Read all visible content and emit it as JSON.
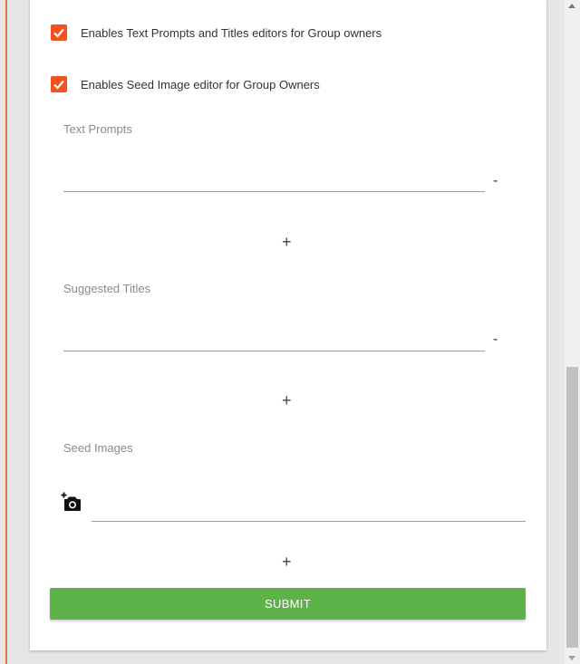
{
  "permissions": {
    "text_editors_label": "Enables Text Prompts and Titles editors for Group owners",
    "text_editors_checked": true,
    "seed_editor_label": "Enables Seed Image editor for Group Owners",
    "seed_editor_checked": true
  },
  "text_prompts": {
    "label": "Text Prompts",
    "value": "",
    "remove_label": "-",
    "add_label": "+"
  },
  "suggested_titles": {
    "label": "Suggested Titles",
    "value": "",
    "remove_label": "-",
    "add_label": "+"
  },
  "seed_images": {
    "label": "Seed Images",
    "icon": "add-photo-icon",
    "add_label": "+"
  },
  "submit_label": "SUBMIT",
  "colors": {
    "checkbox": "#f4511e",
    "submit": "#5db249",
    "accent_border": "#d9774a"
  }
}
